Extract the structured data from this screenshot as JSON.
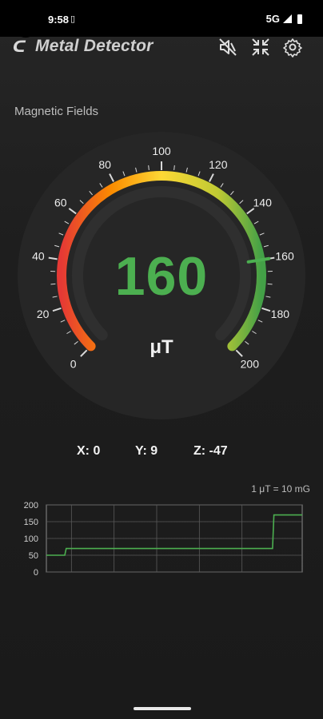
{
  "status": {
    "time": "9:58",
    "network": "5G"
  },
  "app": {
    "title": "Metal Detector",
    "logo_icon": "magnet-icon",
    "actions": [
      {
        "name": "mute-icon",
        "label": "sound off"
      },
      {
        "name": "collapse-icon",
        "label": "collapse"
      },
      {
        "name": "gear-icon",
        "label": "settings"
      }
    ]
  },
  "section_label": "Magnetic Fields",
  "gauge": {
    "value": "160",
    "unit": "μT",
    "min": 0,
    "max": 200,
    "reading": 160,
    "ticks": [
      "0",
      "20",
      "40",
      "60",
      "80",
      "100",
      "120",
      "140",
      "160",
      "180",
      "200"
    ],
    "colors": {
      "low": "#e53935",
      "mid": "#fdd835",
      "high": "#43a047",
      "value_text": "#4caf50"
    }
  },
  "axes": {
    "x": "X: 0",
    "y": "Y: 9",
    "z": "Z: -47"
  },
  "unit_note": "1 μT = 10 mG",
  "chart_data": {
    "type": "line",
    "yticks": [
      "200",
      "150",
      "100",
      "50",
      "0"
    ],
    "ylim": [
      0,
      200
    ],
    "series": [
      {
        "values": [
          50,
          50,
          50,
          50,
          50,
          50,
          50,
          50,
          50,
          50,
          50,
          50,
          50,
          50,
          70,
          70,
          70,
          70,
          70,
          70,
          70,
          70,
          70,
          70,
          70,
          70,
          70,
          70,
          70,
          70,
          70,
          70,
          70,
          70,
          70,
          70,
          70,
          70,
          70,
          70,
          70,
          70,
          70,
          70,
          70,
          70,
          70,
          70,
          70,
          70,
          70,
          70,
          70,
          70,
          70,
          70,
          70,
          70,
          70,
          70,
          70,
          70,
          70,
          70,
          70,
          70,
          70,
          70,
          70,
          70,
          70,
          70,
          70,
          70,
          70,
          70,
          70,
          70,
          70,
          70,
          70,
          70,
          70,
          70,
          70,
          70,
          70,
          70,
          70,
          70,
          70,
          70,
          70,
          70,
          70,
          70,
          70,
          70,
          70,
          70,
          70,
          70,
          70,
          70,
          70,
          70,
          70,
          70,
          70,
          70,
          70,
          70,
          70,
          70,
          70,
          70,
          70,
          70,
          70,
          70,
          70,
          70,
          70,
          70,
          70,
          70,
          70,
          70,
          70,
          70,
          70,
          70,
          70,
          70,
          70,
          70,
          70,
          70,
          70,
          70,
          70,
          70,
          70,
          70,
          70,
          70,
          70,
          70,
          70,
          70,
          70,
          70,
          70,
          70,
          70,
          70,
          70,
          70,
          70,
          70,
          70,
          170,
          170,
          170,
          170,
          170,
          170,
          170,
          170,
          170,
          170,
          170,
          170,
          170,
          170,
          170,
          170,
          170,
          170,
          170,
          170,
          170
        ]
      }
    ],
    "line_color": "#4caf50",
    "grid": true
  }
}
